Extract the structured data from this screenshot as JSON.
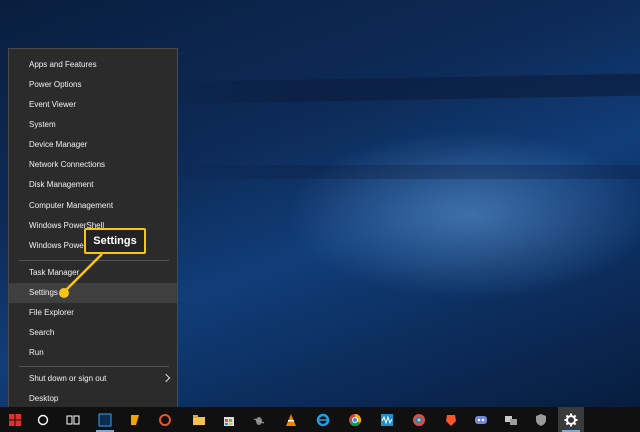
{
  "menu": {
    "items": [
      {
        "label": "Apps and Features"
      },
      {
        "label": "Power Options"
      },
      {
        "label": "Event Viewer"
      },
      {
        "label": "System"
      },
      {
        "label": "Device Manager"
      },
      {
        "label": "Network Connections"
      },
      {
        "label": "Disk Management"
      },
      {
        "label": "Computer Management"
      },
      {
        "label": "Windows PowerShell"
      },
      {
        "label": "Windows PowerShell (Admin)"
      },
      {
        "label": "Task Manager"
      },
      {
        "label": "Settings"
      },
      {
        "label": "File Explorer"
      },
      {
        "label": "Search"
      },
      {
        "label": "Run"
      },
      {
        "label": "Shut down or sign out"
      },
      {
        "label": "Desktop"
      }
    ]
  },
  "callout": {
    "label": "Settings"
  },
  "colors": {
    "callout_accent": "#f5c518",
    "menu_bg": "#2b2b2b",
    "start_red": "#e0312c"
  },
  "taskbar": {
    "icons": [
      "windows-start",
      "cortana-circle",
      "task-view",
      "edge-like",
      "music-app",
      "file-explorer",
      "store",
      "bug-app",
      "vlc",
      "internet-explorer",
      "chrome",
      "wave-app",
      "photos-app",
      "brave",
      "discord",
      "network-app",
      "shield-app",
      "settings-gear"
    ]
  }
}
